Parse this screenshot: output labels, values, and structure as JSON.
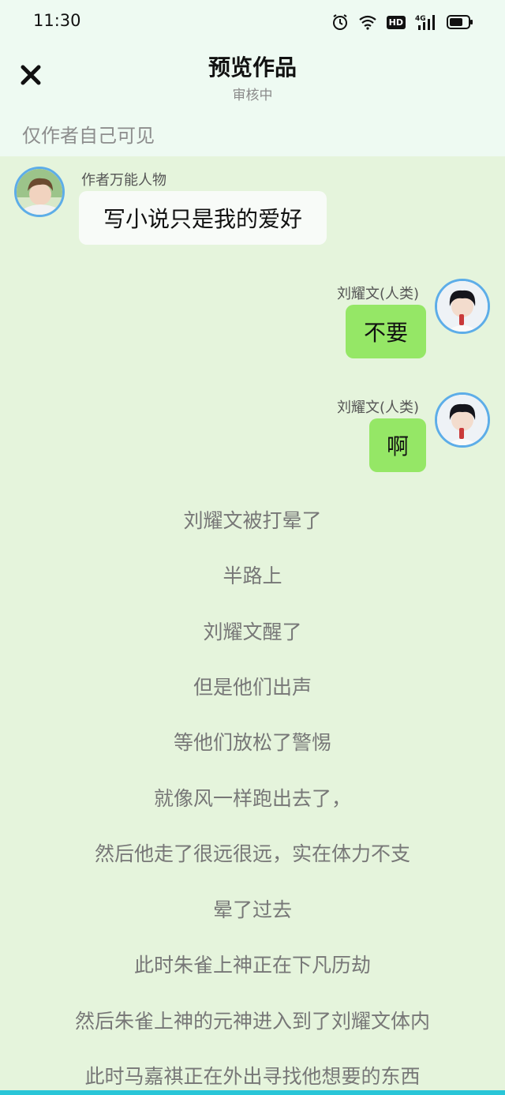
{
  "status": {
    "time": "11:30",
    "hd_badge": "HD",
    "network": "4G"
  },
  "header": {
    "title": "预览作品",
    "subtitle": "审核中",
    "visibility": "仅作者自己可见"
  },
  "messages": [
    {
      "name": "作者万能人物",
      "text": "写小说只是我的爱好"
    },
    {
      "name": "刘耀文(人类)",
      "text": "不要"
    },
    {
      "name": "刘耀文(人类)",
      "text": "啊"
    }
  ],
  "narration": [
    "刘耀文被打晕了",
    "半路上",
    "刘耀文醒了",
    "但是他们出声",
    "等他们放松了警惕",
    "就像风一样跑出去了，",
    "然后他走了很远很远，实在体力不支",
    "晕了过去",
    "此时朱雀上神正在下凡历劫",
    "然后朱雀上神的元神进入到了刘耀文体内",
    "此时马嘉祺正在外出寻找他想要的东西"
  ],
  "colors": {
    "header_bg": "#eefaf2",
    "chat_bg": "#e5f4dc",
    "green_bubble": "#95e766",
    "white_bubble": "#f8fbf8",
    "avatar_border": "#5dade8"
  }
}
